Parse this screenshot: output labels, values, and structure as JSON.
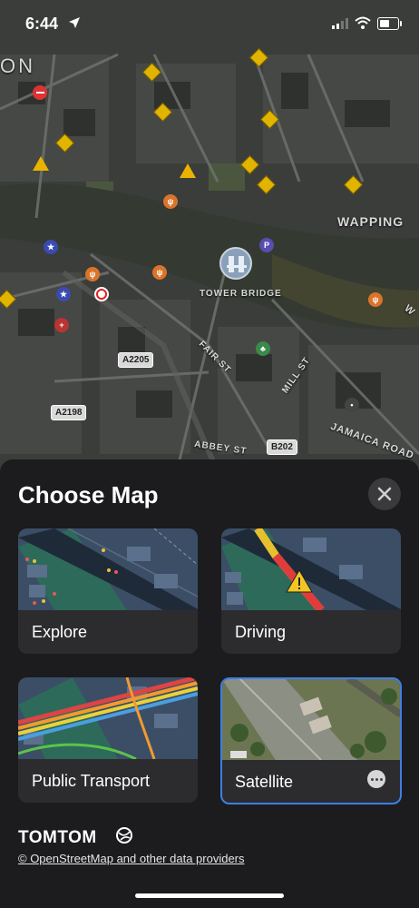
{
  "status_bar": {
    "time": "6:44"
  },
  "map": {
    "labels": {
      "area_top_left": "ON",
      "wapping": "WAPPING",
      "tower_bridge": "TOWER BRIDGE",
      "fair_st": "FAIR ST",
      "mill_st": "MILL ST",
      "jamaica_road": "JAMAICA ROAD",
      "abbey_st": "ABBEY ST",
      "edge_w": "W"
    },
    "road_shields": {
      "a2205": "A2205",
      "a2198": "A2198",
      "b202": "B202"
    }
  },
  "sheet": {
    "title": "Choose Map",
    "options": [
      {
        "label": "Explore"
      },
      {
        "label": "Driving"
      },
      {
        "label": "Public Transport"
      },
      {
        "label": "Satellite",
        "selected": true
      }
    ],
    "brand": "TOMTOM",
    "attribution": "© OpenStreetMap and other data providers"
  },
  "colors": {
    "selected_border": "#3f7ee6",
    "sheet_bg": "#1c1c1e",
    "card_bg": "#2c2c2e",
    "warning": "#e9b300"
  },
  "icons": [
    "location-arrow-icon",
    "cellular-signal-icon",
    "wifi-icon",
    "battery-icon",
    "close-icon",
    "more-icon",
    "tomtom-globe-icon"
  ]
}
